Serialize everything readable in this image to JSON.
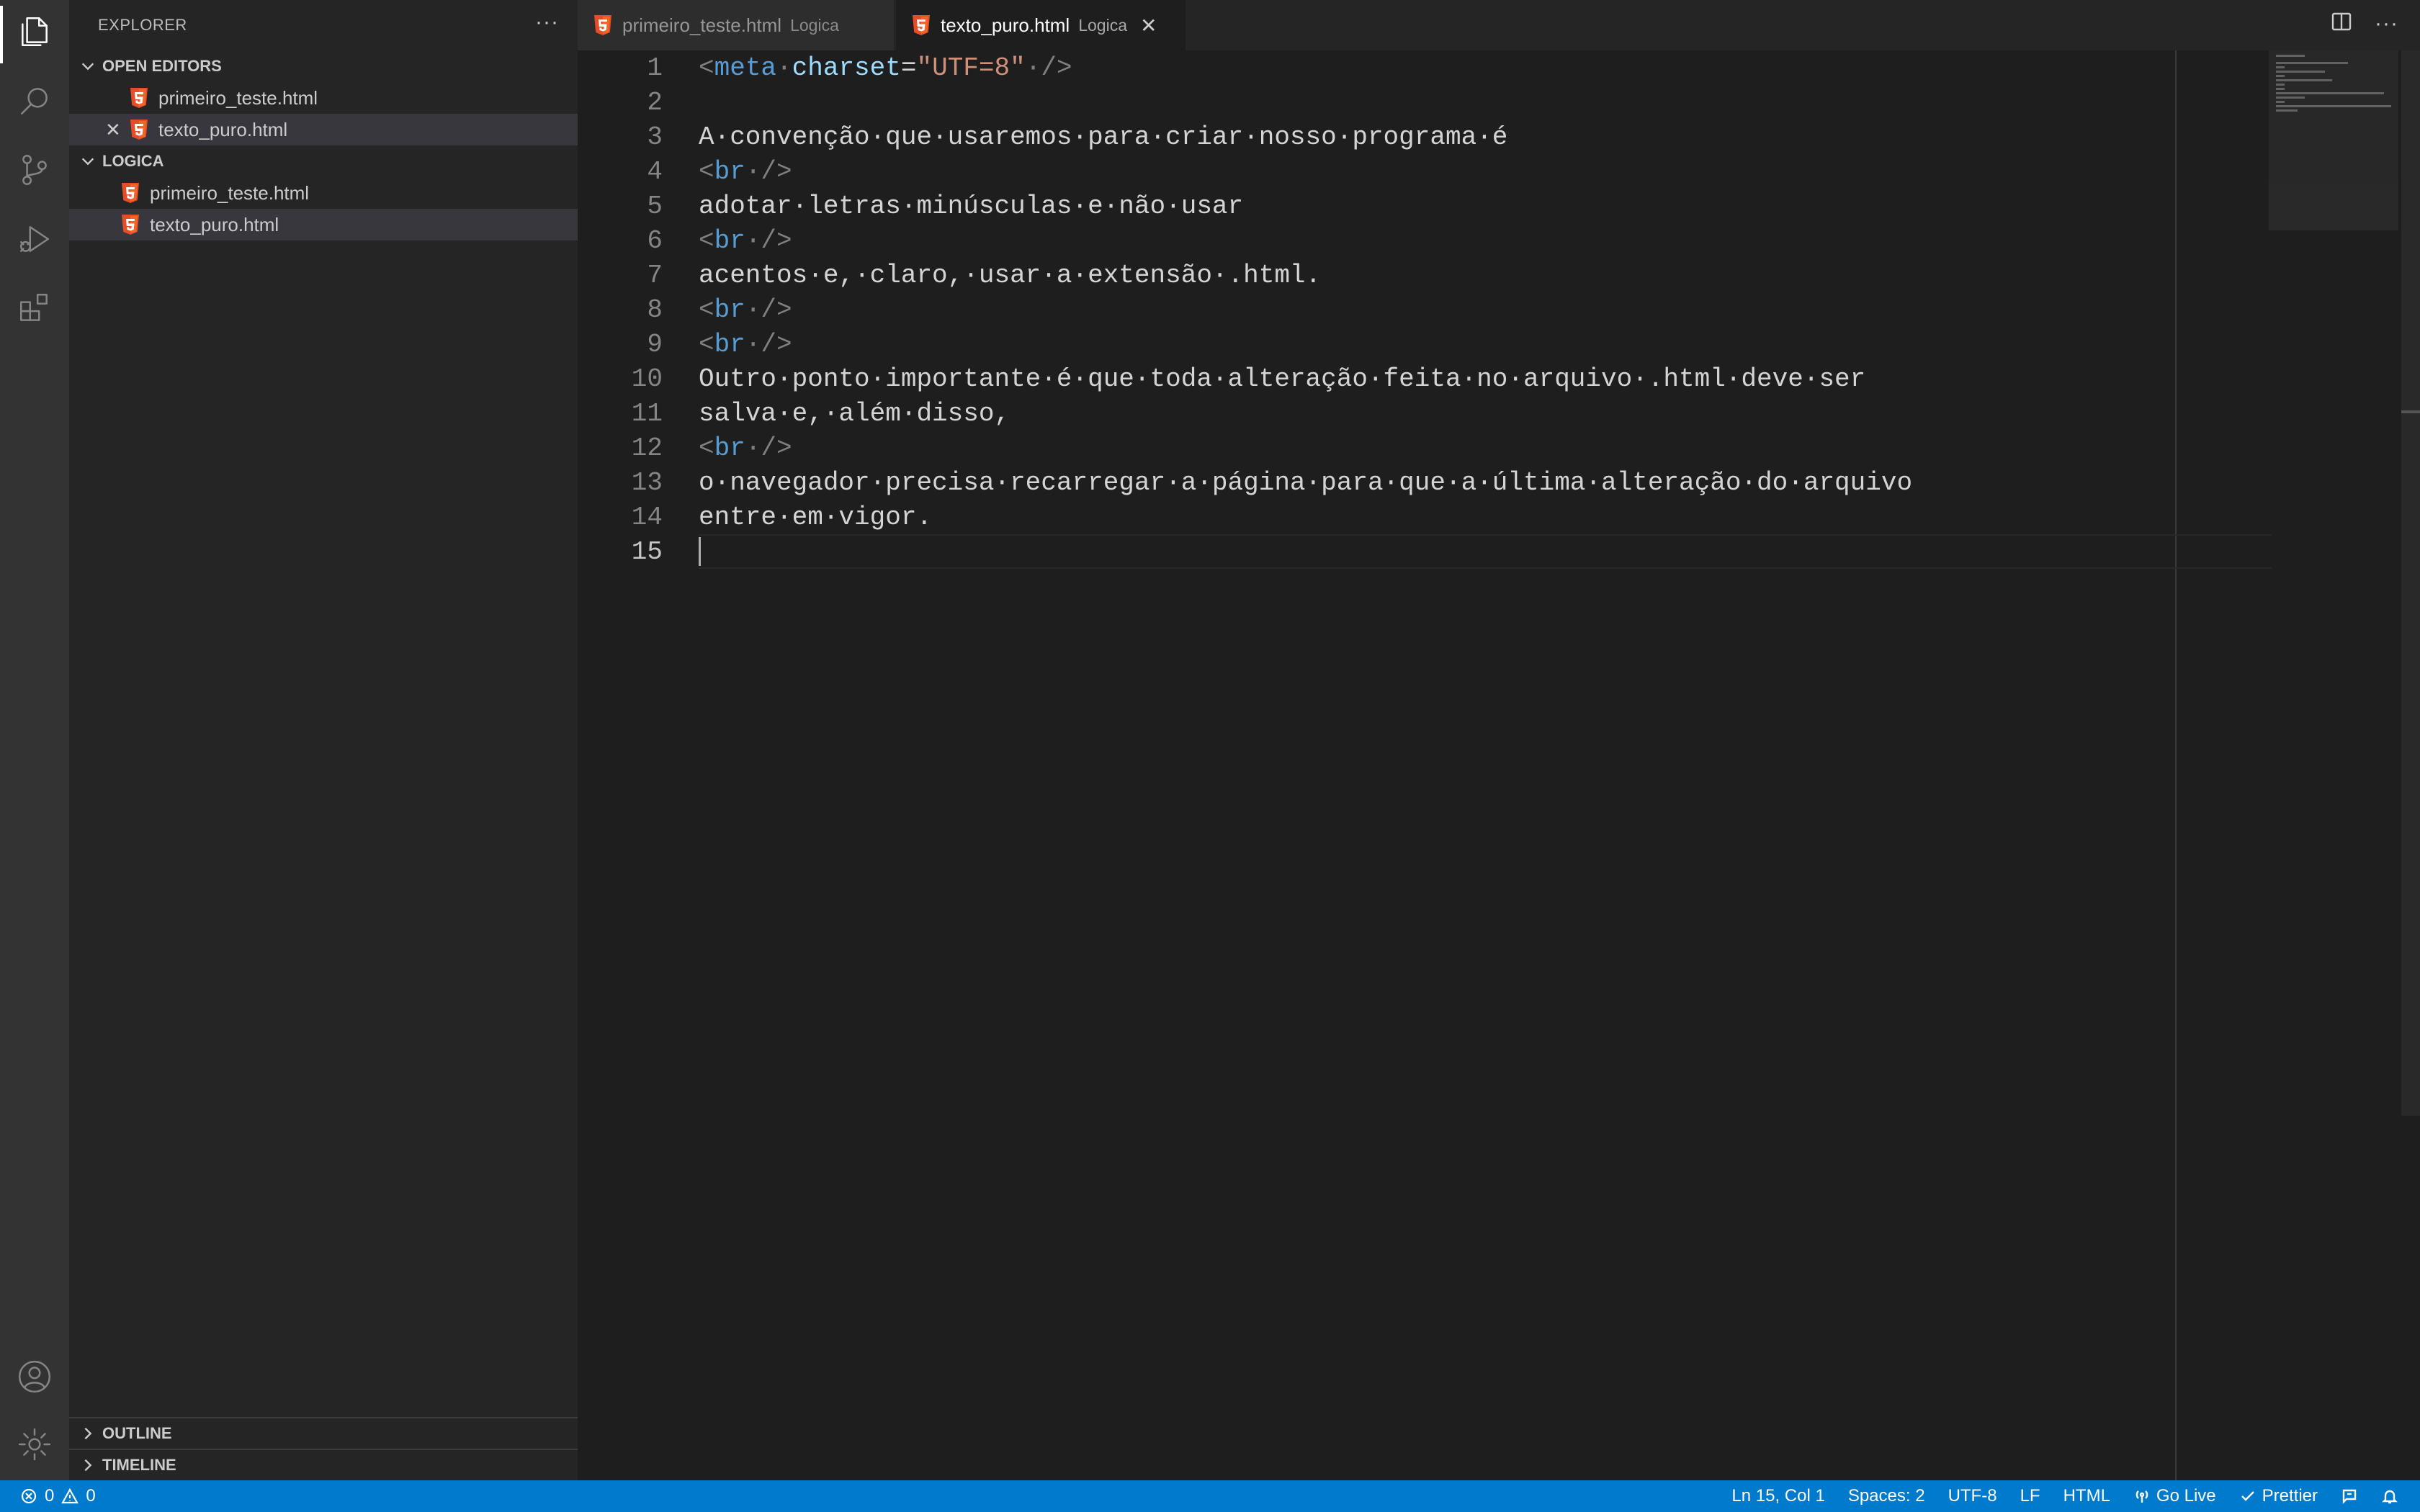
{
  "sidebar": {
    "title": "EXPLORER",
    "more": "···",
    "open_editors": {
      "heading": "OPEN EDITORS",
      "files": [
        "primeiro_teste.html",
        "texto_puro.html"
      ]
    },
    "folder": {
      "heading": "LOGICA",
      "files": [
        "primeiro_teste.html",
        "texto_puro.html"
      ]
    },
    "outline": "OUTLINE",
    "timeline": "TIMELINE"
  },
  "tabs": [
    {
      "name": "primeiro_teste.html",
      "desc": "Logica"
    },
    {
      "name": "texto_puro.html",
      "desc": "Logica"
    }
  ],
  "editor": {
    "line_numbers": [
      "1",
      "2",
      "3",
      "4",
      "5",
      "6",
      "7",
      "8",
      "9",
      "10",
      "11",
      "12",
      "13",
      "14",
      "15"
    ],
    "lines": {
      "l3": "A·convenção·que·usaremos·para·criar·nosso·programa·é",
      "l5": "adotar·letras·minúsculas·e·não·usar",
      "l7": "acentos·e,·claro,·usar·a·extensão·.html.",
      "l10": "Outro·ponto·importante·é·que·toda·alteração·feita·no·arquivo·.html·deve·ser",
      "l11": "salva·e,·além·disso,",
      "l13": "o·navegador·precisa·recarregar·a·página·para·que·a·última·alteração·do·arquivo",
      "l14": "entre·em·vigor."
    },
    "meta": {
      "open": "<",
      "tag": "meta",
      "attr": "charset",
      "eq": "=",
      "value": "\"UTF=8\"",
      "close": "·/>"
    },
    "br": {
      "open": "<",
      "tag": "br",
      "close": "·/>"
    }
  },
  "status": {
    "errors": "0",
    "warnings": "0",
    "position": "Ln 15, Col 1",
    "spaces": "Spaces: 2",
    "encoding": "UTF-8",
    "eol": "LF",
    "language": "HTML",
    "golive": "Go Live",
    "prettier": "Prettier"
  },
  "colors": {
    "accent": "#007acc",
    "html_icon": "#e44d26"
  }
}
